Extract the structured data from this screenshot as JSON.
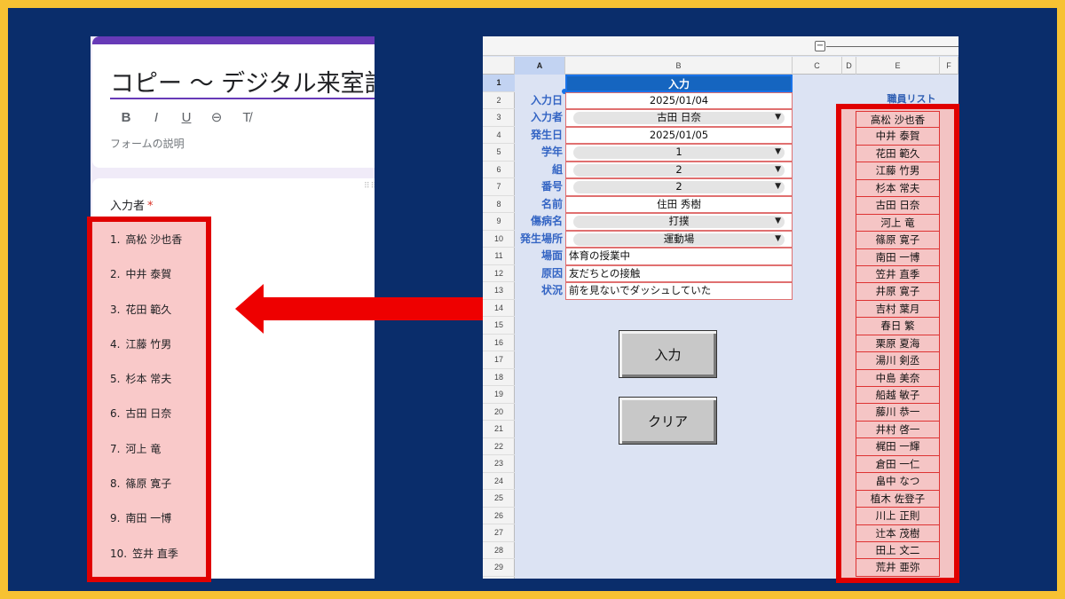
{
  "form": {
    "title": "コピー ～ デジタル来室記",
    "toolbar": [
      {
        "name": "bold-icon",
        "glyph": "B"
      },
      {
        "name": "italic-icon",
        "glyph": "I"
      },
      {
        "name": "underline-icon",
        "glyph": "U"
      },
      {
        "name": "link-icon",
        "glyph": "⊖"
      },
      {
        "name": "clear-format-icon",
        "glyph": "T̸"
      }
    ],
    "description_placeholder": "フォームの説明",
    "question_label": "入力者",
    "required_mark": "*",
    "options": [
      {
        "num": "1.",
        "label": "高松 沙也香"
      },
      {
        "num": "2.",
        "label": "中井 泰賀"
      },
      {
        "num": "3.",
        "label": "花田 範久"
      },
      {
        "num": "4.",
        "label": "江藤 竹男"
      },
      {
        "num": "5.",
        "label": "杉本 常夫"
      },
      {
        "num": "6.",
        "label": "古田 日奈"
      },
      {
        "num": "7.",
        "label": "河上 竜"
      },
      {
        "num": "8.",
        "label": "篠原 寛子"
      },
      {
        "num": "9.",
        "label": "南田 一博"
      },
      {
        "num": "10.",
        "label": "笠井 直季"
      }
    ]
  },
  "sheet": {
    "columns": [
      "A",
      "B",
      "C",
      "D",
      "E",
      "F"
    ],
    "rows": [
      "1",
      "2",
      "3",
      "4",
      "5",
      "6",
      "7",
      "8",
      "9",
      "10",
      "11",
      "12",
      "13",
      "14",
      "15",
      "16",
      "17",
      "18",
      "19",
      "20",
      "21",
      "22",
      "23",
      "24",
      "25",
      "26",
      "27",
      "28",
      "29"
    ],
    "header": "入力",
    "fields": [
      {
        "label": "入力日",
        "value": "2025/01/04",
        "type": "text-center"
      },
      {
        "label": "入力者",
        "value": "古田 日奈",
        "type": "dropdown"
      },
      {
        "label": "発生日",
        "value": "2025/01/05",
        "type": "text-center"
      },
      {
        "label": "学年",
        "value": "1",
        "type": "dropdown"
      },
      {
        "label": "組",
        "value": "2",
        "type": "dropdown"
      },
      {
        "label": "番号",
        "value": "2",
        "type": "dropdown"
      },
      {
        "label": "名前",
        "value": "住田 秀樹",
        "type": "text-center"
      },
      {
        "label": "傷病名",
        "value": "打撲",
        "type": "dropdown"
      },
      {
        "label": "発生場所",
        "value": "運動場",
        "type": "dropdown"
      },
      {
        "label": "場面",
        "value": "体育の授業中",
        "type": "text-left"
      },
      {
        "label": "原因",
        "value": "友だちとの接触",
        "type": "text-left"
      },
      {
        "label": "状況",
        "value": "前を見ないでダッシュしていた",
        "type": "text-left"
      }
    ],
    "dropdown_glyph": "▼",
    "input_button": "入力",
    "clear_button": "クリア",
    "staff_title": "職員リスト",
    "staff": [
      "高松 沙也香",
      "中井 泰賀",
      "花田 範久",
      "江藤 竹男",
      "杉本 常夫",
      "古田 日奈",
      "河上 竜",
      "篠原 寛子",
      "南田 一博",
      "笠井 直季",
      "井原 寛子",
      "吉村 葉月",
      "春日 繁",
      "栗原 夏海",
      "湯川 剣丞",
      "中島 美奈",
      "船越 敏子",
      "藤川 恭一",
      "井村 啓一",
      "梶田 一輝",
      "倉田 一仁",
      "畠中 なつ",
      "植木 佐登子",
      "川上 正則",
      "辻本 茂樹",
      "田上 文二",
      "荒井 亜弥"
    ]
  },
  "colors": {
    "background_frame": "#0a2d6b",
    "border_yellow": "#f7c233",
    "highlight_red": "#e00000",
    "forms_purple": "#673ab7"
  }
}
